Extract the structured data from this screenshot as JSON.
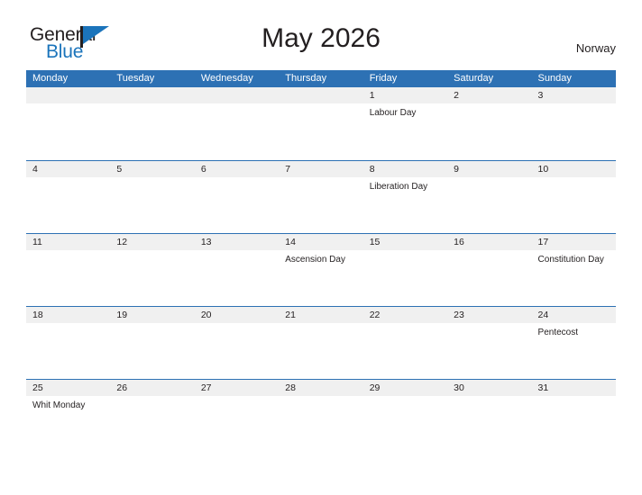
{
  "brand": {
    "name_part1": "General",
    "name_part2": "Blue",
    "accent_color": "#1b74bb",
    "flag_icon": "flag-triangle-icon"
  },
  "header": {
    "title": "May 2026",
    "region": "Norway"
  },
  "calendar": {
    "header_bg": "#2d71b4",
    "date_band_bg": "#f0f0f0",
    "weekdays": [
      "Monday",
      "Tuesday",
      "Wednesday",
      "Thursday",
      "Friday",
      "Saturday",
      "Sunday"
    ],
    "weeks": [
      [
        {
          "day": "",
          "events": []
        },
        {
          "day": "",
          "events": []
        },
        {
          "day": "",
          "events": []
        },
        {
          "day": "",
          "events": []
        },
        {
          "day": "1",
          "events": [
            "Labour Day"
          ]
        },
        {
          "day": "2",
          "events": []
        },
        {
          "day": "3",
          "events": []
        }
      ],
      [
        {
          "day": "4",
          "events": []
        },
        {
          "day": "5",
          "events": []
        },
        {
          "day": "6",
          "events": []
        },
        {
          "day": "7",
          "events": []
        },
        {
          "day": "8",
          "events": [
            "Liberation Day"
          ]
        },
        {
          "day": "9",
          "events": []
        },
        {
          "day": "10",
          "events": []
        }
      ],
      [
        {
          "day": "11",
          "events": []
        },
        {
          "day": "12",
          "events": []
        },
        {
          "day": "13",
          "events": []
        },
        {
          "day": "14",
          "events": [
            "Ascension Day"
          ]
        },
        {
          "day": "15",
          "events": []
        },
        {
          "day": "16",
          "events": []
        },
        {
          "day": "17",
          "events": [
            "Constitution Day"
          ]
        }
      ],
      [
        {
          "day": "18",
          "events": []
        },
        {
          "day": "19",
          "events": []
        },
        {
          "day": "20",
          "events": []
        },
        {
          "day": "21",
          "events": []
        },
        {
          "day": "22",
          "events": []
        },
        {
          "day": "23",
          "events": []
        },
        {
          "day": "24",
          "events": [
            "Pentecost"
          ]
        }
      ],
      [
        {
          "day": "25",
          "events": [
            "Whit Monday"
          ]
        },
        {
          "day": "26",
          "events": []
        },
        {
          "day": "27",
          "events": []
        },
        {
          "day": "28",
          "events": []
        },
        {
          "day": "29",
          "events": []
        },
        {
          "day": "30",
          "events": []
        },
        {
          "day": "31",
          "events": []
        }
      ]
    ]
  }
}
